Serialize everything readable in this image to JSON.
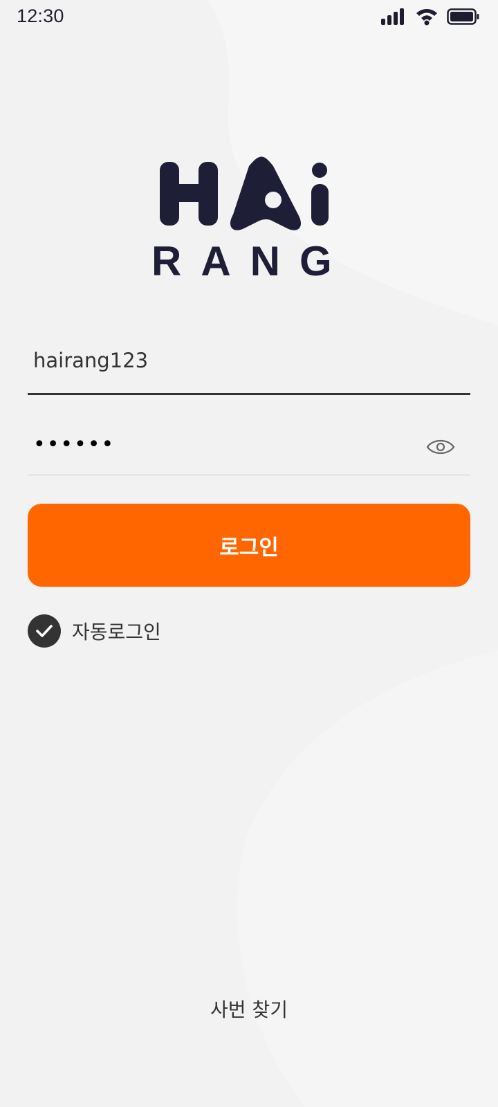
{
  "status_bar": {
    "time": "12:30",
    "icons": [
      "signal-icon",
      "wifi-icon",
      "battery-icon"
    ]
  },
  "logo": {
    "mark": "HAi",
    "wordmark": "RANG",
    "color": "#1e1e37"
  },
  "login_form": {
    "id_value": "hairang123",
    "password_value": "••••••",
    "password_visibility_icon": "eye-icon",
    "login_button_label": "로그인",
    "auto_login_label": "자동로그인",
    "auto_login_checked": true
  },
  "footer": {
    "find_id_label": "사번 찾기"
  },
  "colors": {
    "accent": "#ff6600",
    "background": "#f2f2f2",
    "text_dark": "#333333"
  }
}
